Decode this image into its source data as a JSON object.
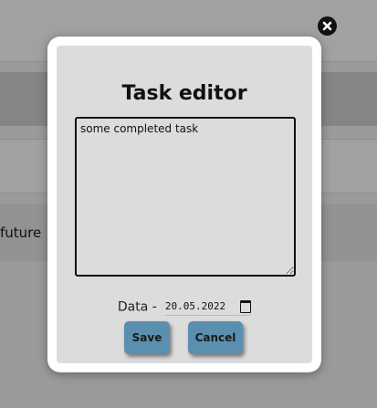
{
  "background": {
    "row_text": "future"
  },
  "modal": {
    "title": "Task editor",
    "task_text": "some completed task",
    "date_label": "Data -",
    "date_value": "20.05.2022",
    "save_label": "Save",
    "cancel_label": "Cancel"
  },
  "icons": {
    "close": "close-icon",
    "calendar": "calendar-icon"
  },
  "colors": {
    "button": "#5b8fb0",
    "modal_panel": "#dcdcdc",
    "overlay": "#9a9a9a"
  }
}
